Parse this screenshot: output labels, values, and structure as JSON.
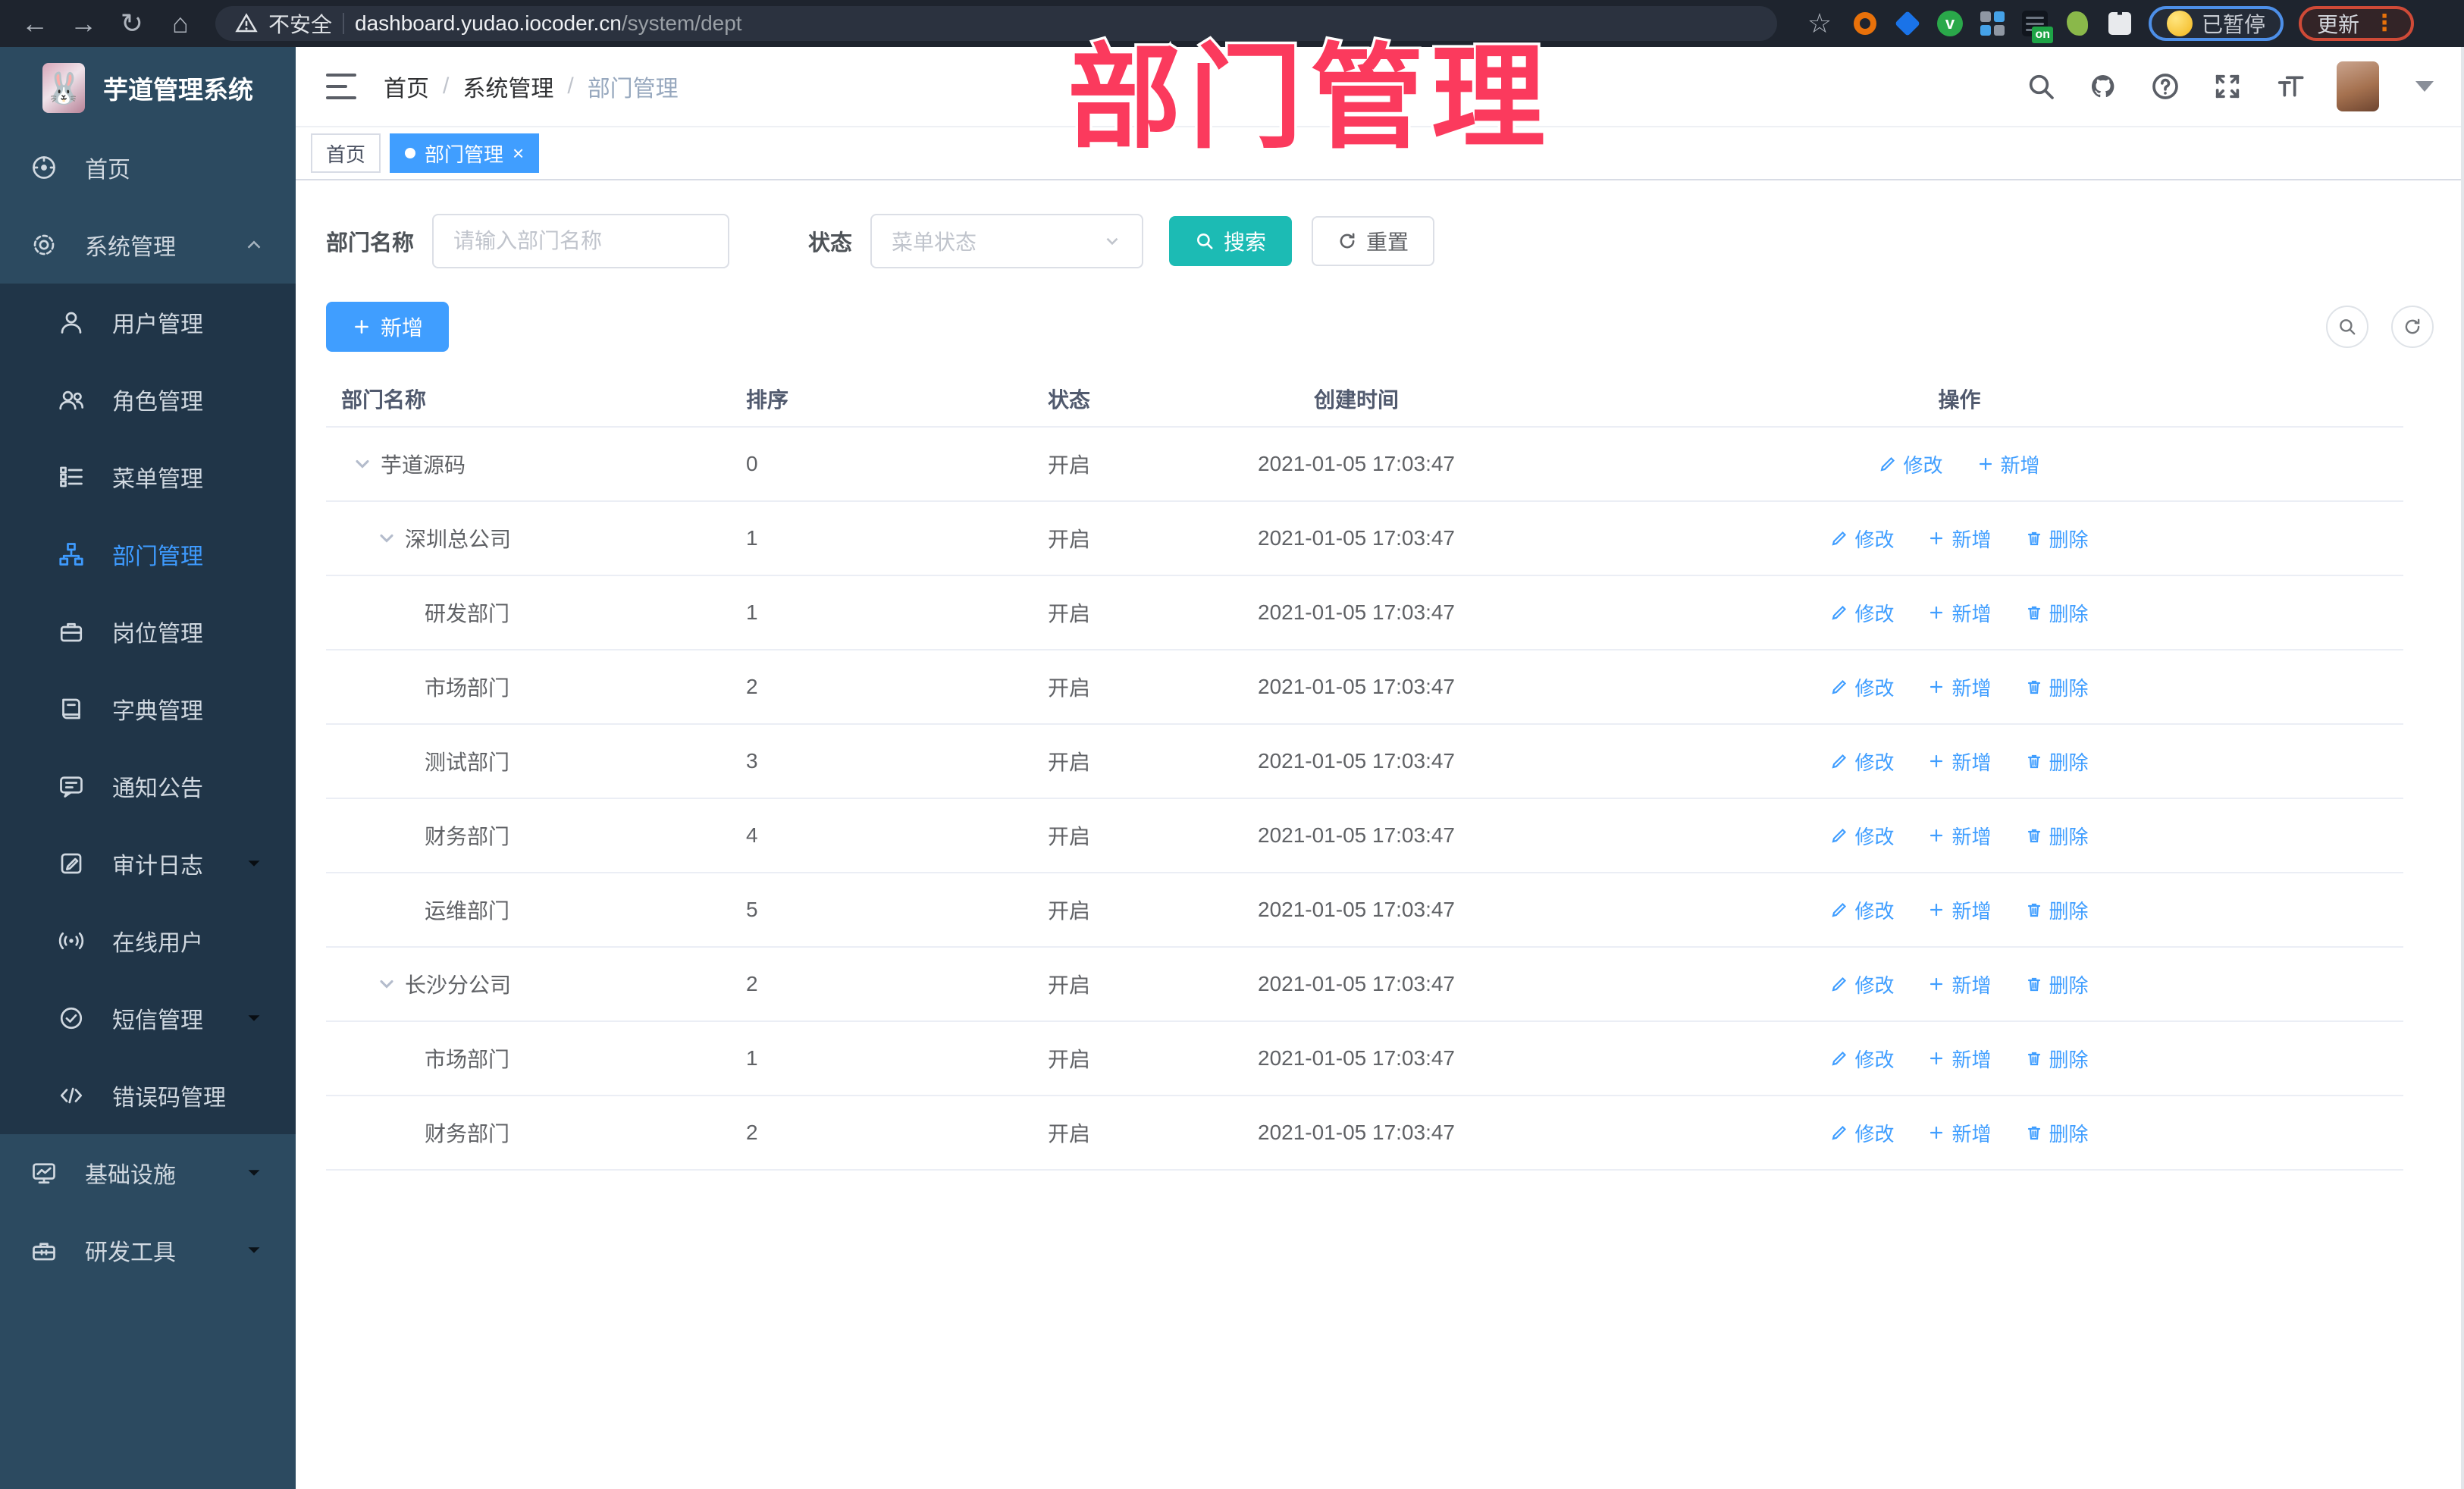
{
  "browser": {
    "security_label": "不安全",
    "url_host": "dashboard.yudao.iocoder.cn",
    "url_path": "/system/dept",
    "paused_badge": "已暂停",
    "update_button": "更新",
    "menu_dots": "⋮",
    "ext_on_badge": "on"
  },
  "annotation": {
    "watermark": "部门管理",
    "color": "#fb3a5d"
  },
  "sidebar": {
    "logo_title": "芋道管理系统",
    "items": [
      {
        "label": "首页"
      },
      {
        "label": "系统管理"
      },
      {
        "label": "用户管理"
      },
      {
        "label": "角色管理"
      },
      {
        "label": "菜单管理"
      },
      {
        "label": "部门管理"
      },
      {
        "label": "岗位管理"
      },
      {
        "label": "字典管理"
      },
      {
        "label": "通知公告"
      },
      {
        "label": "审计日志"
      },
      {
        "label": "在线用户"
      },
      {
        "label": "短信管理"
      },
      {
        "label": "错误码管理"
      },
      {
        "label": "基础设施"
      },
      {
        "label": "研发工具"
      }
    ]
  },
  "header": {
    "breadcrumb": [
      "首页",
      "系统管理",
      "部门管理"
    ],
    "separator": "/"
  },
  "tabs": [
    {
      "label": "首页"
    },
    {
      "label": "部门管理",
      "close_glyph": "×"
    }
  ],
  "filters": {
    "name_label": "部门名称",
    "name_placeholder": "请输入部门名称",
    "status_label": "状态",
    "status_placeholder": "菜单状态",
    "search_button": "搜索",
    "reset_button": "重置"
  },
  "toolbar": {
    "add_button": "新增"
  },
  "table": {
    "columns": [
      "部门名称",
      "排序",
      "状态",
      "创建时间",
      "操作"
    ],
    "actions": {
      "edit": "修改",
      "add": "新增",
      "delete": "删除"
    },
    "rows": [
      {
        "name": "芋道源码",
        "sort": "0",
        "status": "开启",
        "created": "2021-01-05 17:03:47"
      },
      {
        "name": "深圳总公司",
        "sort": "1",
        "status": "开启",
        "created": "2021-01-05 17:03:47"
      },
      {
        "name": "研发部门",
        "sort": "1",
        "status": "开启",
        "created": "2021-01-05 17:03:47"
      },
      {
        "name": "市场部门",
        "sort": "2",
        "status": "开启",
        "created": "2021-01-05 17:03:47"
      },
      {
        "name": "测试部门",
        "sort": "3",
        "status": "开启",
        "created": "2021-01-05 17:03:47"
      },
      {
        "name": "财务部门",
        "sort": "4",
        "status": "开启",
        "created": "2021-01-05 17:03:47"
      },
      {
        "name": "运维部门",
        "sort": "5",
        "status": "开启",
        "created": "2021-01-05 17:03:47"
      },
      {
        "name": "长沙分公司",
        "sort": "2",
        "status": "开启",
        "created": "2021-01-05 17:03:47"
      },
      {
        "name": "市场部门",
        "sort": "1",
        "status": "开启",
        "created": "2021-01-05 17:03:47"
      },
      {
        "name": "财务部门",
        "sort": "2",
        "status": "开启",
        "created": "2021-01-05 17:03:47"
      }
    ]
  }
}
